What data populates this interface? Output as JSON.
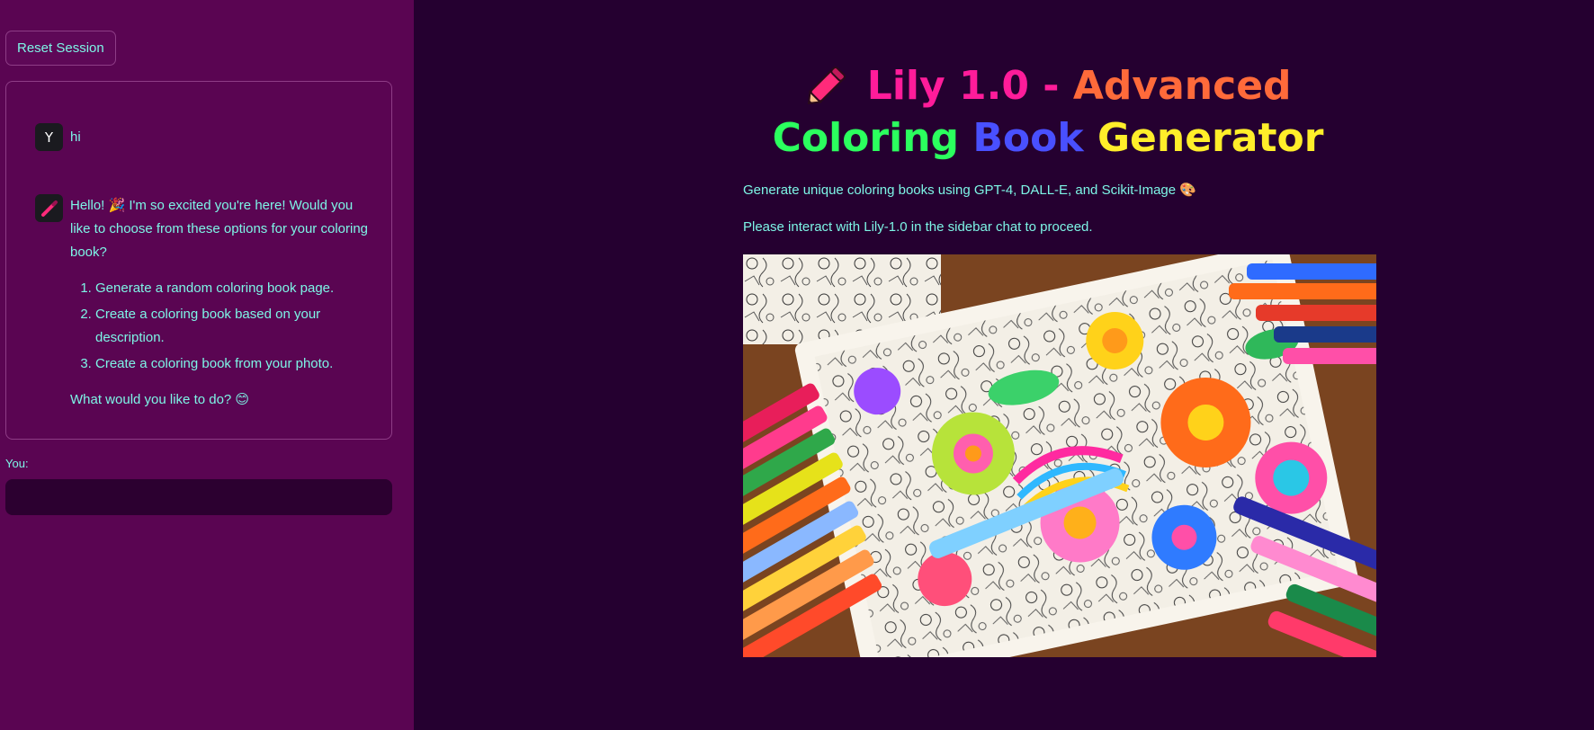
{
  "sidebar": {
    "reset_label": "Reset Session",
    "you_label": "You:",
    "input_value": "",
    "messages": {
      "user": {
        "avatar": "Y",
        "text": "hi"
      },
      "bot": {
        "avatar_icon": "pencil-icon",
        "intro": "Hello! 🎉 I'm so excited you're here! Would you like to choose from these options for your coloring book?",
        "options": [
          "Generate a random coloring book page.",
          "Create a coloring book based on your description.",
          "Create a coloring book from your photo."
        ],
        "outro": "What would you like to do? 😊"
      }
    }
  },
  "main": {
    "title": {
      "part1": "Lily 1.0 -",
      "part2": "Advanced",
      "part3": "Coloring",
      "part4": "Book",
      "part5": "Generator"
    },
    "description": "Generate unique coloring books using GPT-4, DALL-E, and Scikit-Image 🎨",
    "note": "Please interact with Lily-1.0 in the sidebar chat to proceed."
  },
  "colors": {
    "sidebar_bg": "#5a0552",
    "main_bg": "#250030",
    "text": "#7df5e6",
    "pink": "#ff1c9a",
    "orange": "#ff6a3a",
    "green": "#2bff5e",
    "blue": "#4950ff",
    "yellow": "#ffee2a"
  }
}
